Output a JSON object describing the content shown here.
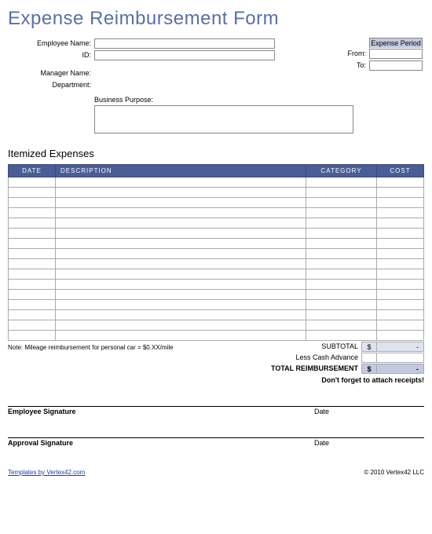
{
  "title": "Expense Reimbursement Form",
  "fields": {
    "employee_name": "Employee Name:",
    "id": "ID:",
    "manager_name": "Manager Name:",
    "department": "Department:",
    "business_purpose": "Business Purpose:"
  },
  "period": {
    "header": "Expense Period",
    "from": "From:",
    "to": "To:"
  },
  "section_title": "Itemized Expenses",
  "columns": {
    "date": "DATE",
    "description": "DESCRIPTION",
    "category": "CATEGORY",
    "cost": "COST"
  },
  "row_count": 16,
  "note": "Note: Mileage reimbursement for personal car = $0.XX/mile",
  "totals": {
    "subtotal": "SUBTOTAL",
    "subtotal_currency": "$",
    "subtotal_value": "-",
    "less_cash": "Less Cash Advance",
    "less_cash_value": "",
    "grand": "TOTAL REIMBURSEMENT",
    "grand_currency": "$",
    "grand_value": "-"
  },
  "reminder": "Don't forget to attach receipts!",
  "signatures": {
    "employee": "Employee Signature",
    "approval": "Approval Signature",
    "date": "Date"
  },
  "footer": {
    "link_text": "Templates by Vertex42.com",
    "copyright": "© 2010 Vertex42 LLC"
  }
}
